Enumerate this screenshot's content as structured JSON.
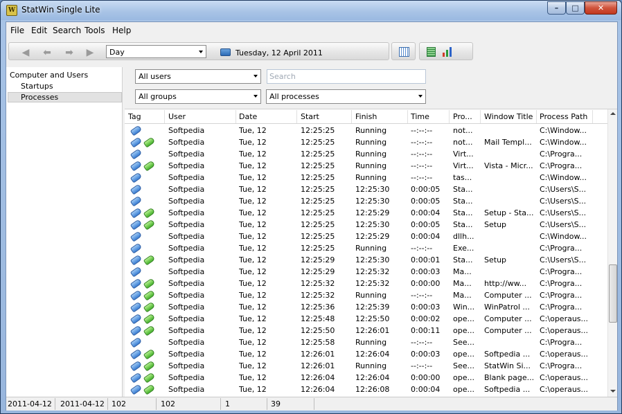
{
  "window": {
    "title": "StatWin Single Lite",
    "icon_letter": "W"
  },
  "menu": [
    "File",
    "Edit",
    "Search",
    "Tools",
    "Help"
  ],
  "toolbar": {
    "period": "Day",
    "date": "Tuesday, 12 April 2011"
  },
  "tree": {
    "root": "Computer and Users",
    "children": [
      "Startups",
      "Processes"
    ],
    "selected": "Processes"
  },
  "filters": {
    "users": "All users",
    "groups": "All groups",
    "search_placeholder": "Search",
    "processes": "All processes"
  },
  "columns": [
    "Tag",
    "User",
    "Date",
    "Start",
    "Finish",
    "Time",
    "Pro...",
    "Window Title",
    "Process Path"
  ],
  "rows": [
    {
      "green": false,
      "user": "Softpedia",
      "date": "Tue, 12",
      "start": "12:25:25",
      "finish": "Running",
      "time": "--:--:--",
      "pro": "not...",
      "title": "",
      "path": "C:\\Window..."
    },
    {
      "green": true,
      "user": "Softpedia",
      "date": "Tue, 12",
      "start": "12:25:25",
      "finish": "Running",
      "time": "--:--:--",
      "pro": "not...",
      "title": "Mail Templ...",
      "path": "C:\\Window..."
    },
    {
      "green": false,
      "user": "Softpedia",
      "date": "Tue, 12",
      "start": "12:25:25",
      "finish": "Running",
      "time": "--:--:--",
      "pro": "Virt...",
      "title": "",
      "path": "C:\\Progra..."
    },
    {
      "green": true,
      "user": "Softpedia",
      "date": "Tue, 12",
      "start": "12:25:25",
      "finish": "Running",
      "time": "--:--:--",
      "pro": "Virt...",
      "title": "Vista - Micr...",
      "path": "C:\\Progra..."
    },
    {
      "green": false,
      "user": "Softpedia",
      "date": "Tue, 12",
      "start": "12:25:25",
      "finish": "Running",
      "time": "--:--:--",
      "pro": "tas...",
      "title": "",
      "path": "C:\\Window..."
    },
    {
      "green": false,
      "user": "Softpedia",
      "date": "Tue, 12",
      "start": "12:25:25",
      "finish": "12:25:30",
      "time": "0:00:05",
      "pro": "Sta...",
      "title": "",
      "path": "C:\\Users\\S..."
    },
    {
      "green": false,
      "user": "Softpedia",
      "date": "Tue, 12",
      "start": "12:25:25",
      "finish": "12:25:30",
      "time": "0:00:05",
      "pro": "Sta...",
      "title": "",
      "path": "C:\\Users\\S..."
    },
    {
      "green": true,
      "user": "Softpedia",
      "date": "Tue, 12",
      "start": "12:25:25",
      "finish": "12:25:29",
      "time": "0:00:04",
      "pro": "Sta...",
      "title": "Setup - Sta...",
      "path": "C:\\Users\\S..."
    },
    {
      "green": true,
      "user": "Softpedia",
      "date": "Tue, 12",
      "start": "12:25:25",
      "finish": "12:25:30",
      "time": "0:00:05",
      "pro": "Sta...",
      "title": "Setup",
      "path": "C:\\Users\\S..."
    },
    {
      "green": false,
      "user": "Softpedia",
      "date": "Tue, 12",
      "start": "12:25:25",
      "finish": "12:25:29",
      "time": "0:00:04",
      "pro": "dllh...",
      "title": "",
      "path": "C:\\Window..."
    },
    {
      "green": false,
      "user": "Softpedia",
      "date": "Tue, 12",
      "start": "12:25:25",
      "finish": "Running",
      "time": "--:--:--",
      "pro": "Exe...",
      "title": "",
      "path": "C:\\Progra..."
    },
    {
      "green": true,
      "user": "Softpedia",
      "date": "Tue, 12",
      "start": "12:25:29",
      "finish": "12:25:30",
      "time": "0:00:01",
      "pro": "Sta...",
      "title": "Setup",
      "path": "C:\\Users\\S..."
    },
    {
      "green": false,
      "user": "Softpedia",
      "date": "Tue, 12",
      "start": "12:25:29",
      "finish": "12:25:32",
      "time": "0:00:03",
      "pro": "Ma...",
      "title": "",
      "path": "C:\\Progra..."
    },
    {
      "green": true,
      "user": "Softpedia",
      "date": "Tue, 12",
      "start": "12:25:32",
      "finish": "12:25:32",
      "time": "0:00:00",
      "pro": "Ma...",
      "title": "http://ww...",
      "path": "C:\\Progra..."
    },
    {
      "green": true,
      "user": "Softpedia",
      "date": "Tue, 12",
      "start": "12:25:32",
      "finish": "Running",
      "time": "--:--:--",
      "pro": "Ma...",
      "title": "Computer ...",
      "path": "C:\\Progra..."
    },
    {
      "green": true,
      "user": "Softpedia",
      "date": "Tue, 12",
      "start": "12:25:36",
      "finish": "12:25:39",
      "time": "0:00:03",
      "pro": "Win...",
      "title": "WinPatrol ...",
      "path": "C:\\Progra..."
    },
    {
      "green": true,
      "user": "Softpedia",
      "date": "Tue, 12",
      "start": "12:25:48",
      "finish": "12:25:50",
      "time": "0:00:02",
      "pro": "ope...",
      "title": "Computer ...",
      "path": "C:\\operaus..."
    },
    {
      "green": true,
      "user": "Softpedia",
      "date": "Tue, 12",
      "start": "12:25:50",
      "finish": "12:26:01",
      "time": "0:00:11",
      "pro": "ope...",
      "title": "Computer ...",
      "path": "C:\\operaus..."
    },
    {
      "green": false,
      "user": "Softpedia",
      "date": "Tue, 12",
      "start": "12:25:58",
      "finish": "Running",
      "time": "--:--:--",
      "pro": "See...",
      "title": "",
      "path": "C:\\Progra..."
    },
    {
      "green": true,
      "user": "Softpedia",
      "date": "Tue, 12",
      "start": "12:26:01",
      "finish": "12:26:04",
      "time": "0:00:03",
      "pro": "ope...",
      "title": "Softpedia ...",
      "path": "C:\\operaus..."
    },
    {
      "green": true,
      "user": "Softpedia",
      "date": "Tue, 12",
      "start": "12:26:01",
      "finish": "Running",
      "time": "--:--:--",
      "pro": "See...",
      "title": "StatWin Si...",
      "path": "C:\\Progra..."
    },
    {
      "green": true,
      "user": "Softpedia",
      "date": "Tue, 12",
      "start": "12:26:04",
      "finish": "12:26:04",
      "time": "0:00:00",
      "pro": "ope...",
      "title": "Blank page...",
      "path": "C:\\operaus..."
    },
    {
      "green": true,
      "user": "Softpedia",
      "date": "Tue, 12",
      "start": "12:26:04",
      "finish": "12:26:08",
      "time": "0:00:04",
      "pro": "ope...",
      "title": "Softpedia ...",
      "path": "C:\\operaus..."
    },
    {
      "green": true,
      "user": "",
      "date": "",
      "start": "",
      "finish": "",
      "time": "",
      "pro": "",
      "title": "",
      "path": ""
    }
  ],
  "status": [
    "2011-04-12",
    "2011-04-12",
    "102",
    "102",
    "1",
    "39"
  ]
}
